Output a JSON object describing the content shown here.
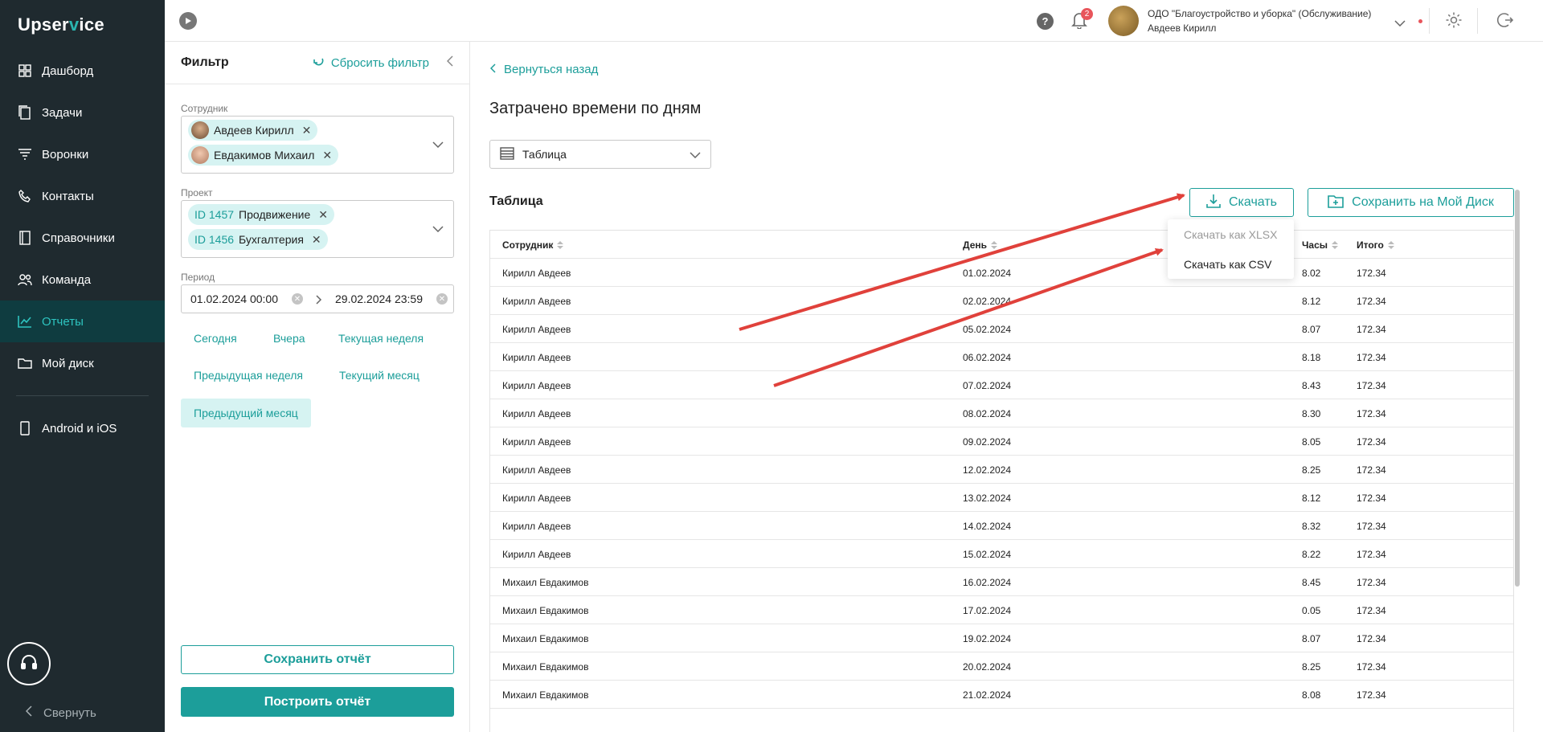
{
  "app": {
    "logo_pre": "Upser",
    "logo_v": "v",
    "logo_post": "ice"
  },
  "sidebar": {
    "items": [
      {
        "label": "Дашборд",
        "icon": "dashboard-icon"
      },
      {
        "label": "Задачи",
        "icon": "tasks-icon"
      },
      {
        "label": "Воронки",
        "icon": "funnel-icon"
      },
      {
        "label": "Контакты",
        "icon": "contacts-icon"
      },
      {
        "label": "Справочники",
        "icon": "book-icon"
      },
      {
        "label": "Команда",
        "icon": "team-icon"
      },
      {
        "label": "Отчеты",
        "icon": "chart-icon",
        "active": true
      },
      {
        "label": "Мой диск",
        "icon": "folder-icon"
      }
    ],
    "mobile_label": "Android и iOS",
    "collapse_label": "Свернуть"
  },
  "topbar": {
    "notifications": "2",
    "org_name": "ОДО \"Благоустройство и уборка\" (Обслуживание)",
    "user_name": "Авдеев Кирилл",
    "help": "?"
  },
  "filter": {
    "title": "Фильтр",
    "reset_label": "Сбросить фильтр",
    "employee_label": "Сотрудник",
    "employees": [
      "Авдеев Кирилл",
      "Евдакимов Михаил"
    ],
    "project_label": "Проект",
    "projects": [
      {
        "id": "ID 1457",
        "name": "Продвижение"
      },
      {
        "id": "ID 1456",
        "name": "Бухгалтерия"
      }
    ],
    "period_label": "Период",
    "period_from": "01.02.2024 00:00",
    "period_to": "29.02.2024 23:59",
    "quick": {
      "today": "Сегодня",
      "yesterday": "Вчера",
      "this_week": "Текущая неделя",
      "prev_week": "Предыдущая неделя",
      "this_month": "Текущий месяц",
      "prev_month": "Предыдущий месяц"
    },
    "save_report": "Сохранить отчёт",
    "build_report": "Построить отчёт"
  },
  "main": {
    "back_label": "Вернуться назад",
    "title": "Затрачено времени по дням",
    "view_select": "Таблица",
    "table_title": "Таблица",
    "download_label": "Скачать",
    "save_disk_label": "Сохранить на Мой Диск",
    "download_menu": [
      "Скачать как XLSX",
      "Скачать как CSV"
    ],
    "columns": [
      "Сотрудник",
      "День",
      "Часы",
      "Итого"
    ],
    "rows": [
      [
        "Кирилл Авдеев",
        "01.02.2024",
        "8.02",
        "172.34"
      ],
      [
        "Кирилл Авдеев",
        "02.02.2024",
        "8.12",
        "172.34"
      ],
      [
        "Кирилл Авдеев",
        "05.02.2024",
        "8.07",
        "172.34"
      ],
      [
        "Кирилл Авдеев",
        "06.02.2024",
        "8.18",
        "172.34"
      ],
      [
        "Кирилл Авдеев",
        "07.02.2024",
        "8.43",
        "172.34"
      ],
      [
        "Кирилл Авдеев",
        "08.02.2024",
        "8.30",
        "172.34"
      ],
      [
        "Кирилл Авдеев",
        "09.02.2024",
        "8.05",
        "172.34"
      ],
      [
        "Кирилл Авдеев",
        "12.02.2024",
        "8.25",
        "172.34"
      ],
      [
        "Кирилл Авдеев",
        "13.02.2024",
        "8.12",
        "172.34"
      ],
      [
        "Кирилл Авдеев",
        "14.02.2024",
        "8.32",
        "172.34"
      ],
      [
        "Кирилл Авдеев",
        "15.02.2024",
        "8.22",
        "172.34"
      ],
      [
        "Михаил Евдакимов",
        "16.02.2024",
        "8.45",
        "172.34"
      ],
      [
        "Михаил Евдакимов",
        "17.02.2024",
        "0.05",
        "172.34"
      ],
      [
        "Михаил Евдакимов",
        "19.02.2024",
        "8.07",
        "172.34"
      ],
      [
        "Михаил Евдакимов",
        "20.02.2024",
        "8.25",
        "172.34"
      ],
      [
        "Михаил Евдакимов",
        "21.02.2024",
        "8.08",
        "172.34"
      ]
    ]
  },
  "colors": {
    "accent": "#1c9e9a",
    "sidebar_bg": "#1f2a2f",
    "arrow": "#e0413b",
    "chip_bg": "#d6f3f2"
  }
}
